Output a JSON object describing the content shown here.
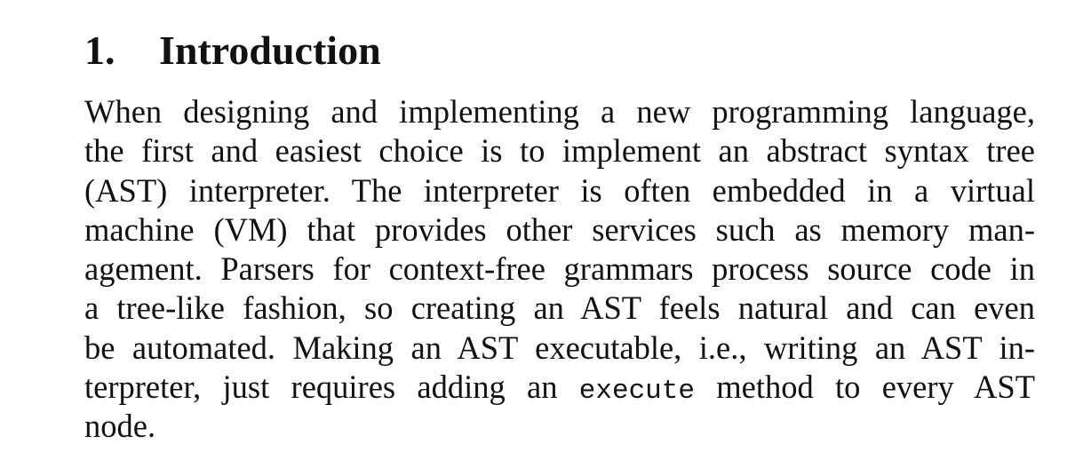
{
  "section": {
    "number": "1.",
    "title": "Introduction"
  },
  "paragraph": {
    "lines": [
      "When designing and implementing a new programming language,",
      "the first and easiest choice is to implement an abstract syntax tree",
      "(AST) interpreter. The interpreter is often embedded in a virtual",
      "machine (VM) that provides other services such as memory man-",
      "agement. Parsers for context-free grammars process source code in",
      "a tree-like fashion, so creating an AST feels natural and can even",
      "be automated. Making an AST executable, i.e., writing an AST in-"
    ],
    "line8_before": "terpreter, just requires adding an",
    "line8_code": "execute",
    "line8_after": "method to every AST",
    "last_line": "node."
  }
}
